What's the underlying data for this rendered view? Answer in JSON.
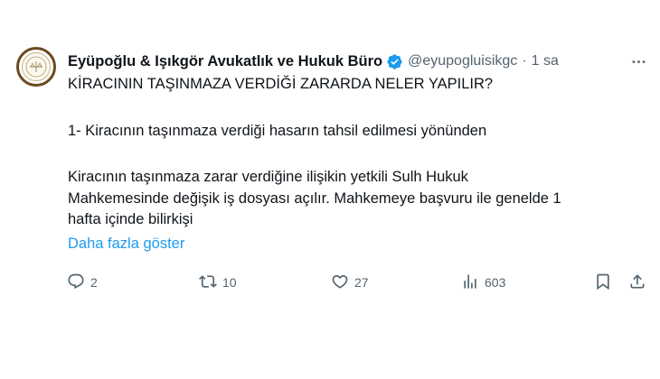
{
  "author": {
    "display_name": "Eyüpoğlu & Işıkgör Avukatlık ve Hukuk Büro",
    "handle": "@eyupogluisikgc",
    "separator": "·",
    "time": "1 sa",
    "verified_color": "#1d9bf0"
  },
  "tweet": {
    "title": "KİRACININ TAŞINMAZA VERDİĞİ ZARARDA NELER YAPILIR?",
    "point": "1- Kiracının taşınmaza verdiği hasarın tahsil edilmesi yönünden",
    "para_line1": "Kiracının taşınmaza zarar verdiğine ilişikin yetkili Sulh Hukuk",
    "para_line2": "Mahkemesinde değişik iş dosyası açılır. Mahkemeye başvuru ile genelde 1",
    "para_line3": "hafta içinde bilirkişi",
    "show_more": "Daha fazla göster"
  },
  "actions": {
    "replies": "2",
    "retweets": "10",
    "likes": "27",
    "views": "603"
  },
  "icons": {
    "more": "more-icon",
    "reply": "reply-icon",
    "retweet": "retweet-icon",
    "like": "heart-icon",
    "views": "views-icon",
    "bookmark": "bookmark-icon",
    "share": "share-icon"
  },
  "colors": {
    "text": "#0f1419",
    "muted": "#536471",
    "link": "#1d9bf0",
    "avatar_ring": "#6b4a1f"
  }
}
